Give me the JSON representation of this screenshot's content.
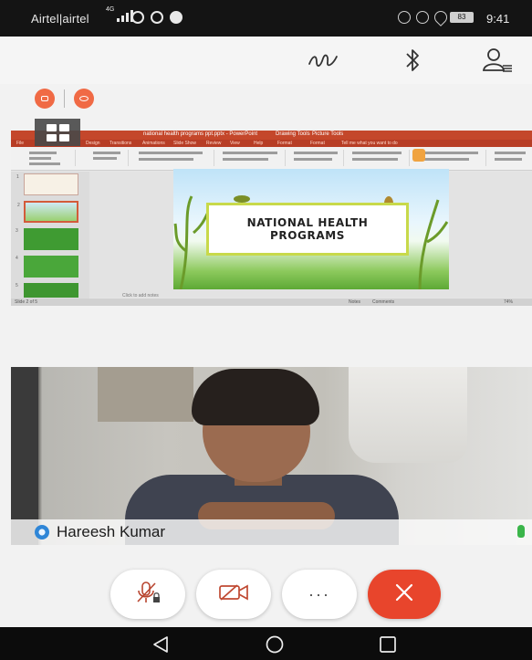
{
  "status_bar": {
    "carrier": "Airtel|airtel",
    "network": "4G",
    "battery": "83",
    "time": "9:41",
    "app_icons": [
      "opera-icon",
      "whatsapp-icon",
      "chat-icon"
    ],
    "system_icons": [
      "nfc-icon",
      "alarm-icon",
      "location-icon"
    ]
  },
  "toolbar": {
    "icons": [
      "annotate-icon",
      "bluetooth-icon",
      "participants-icon"
    ]
  },
  "share_controls": {
    "icons": [
      "stop-share-icon",
      "pause-share-icon"
    ],
    "accent": "#f06a45"
  },
  "shared_screen": {
    "app": "PowerPoint",
    "slide_title": "NATIONAL HEALTH PROGRAMS",
    "slide_count": 5
  },
  "participant": {
    "name": "Hareesh Kumar",
    "mic_color": "#3ab54a"
  },
  "call_controls": {
    "icons": [
      "mute-mic-icon",
      "video-camera-icon",
      "more-icon",
      "end-call-icon"
    ],
    "more_label": "···",
    "end_color": "#e8452c"
  },
  "nav_bar": {
    "icons": [
      "back-icon",
      "home-icon",
      "recents-icon"
    ]
  }
}
